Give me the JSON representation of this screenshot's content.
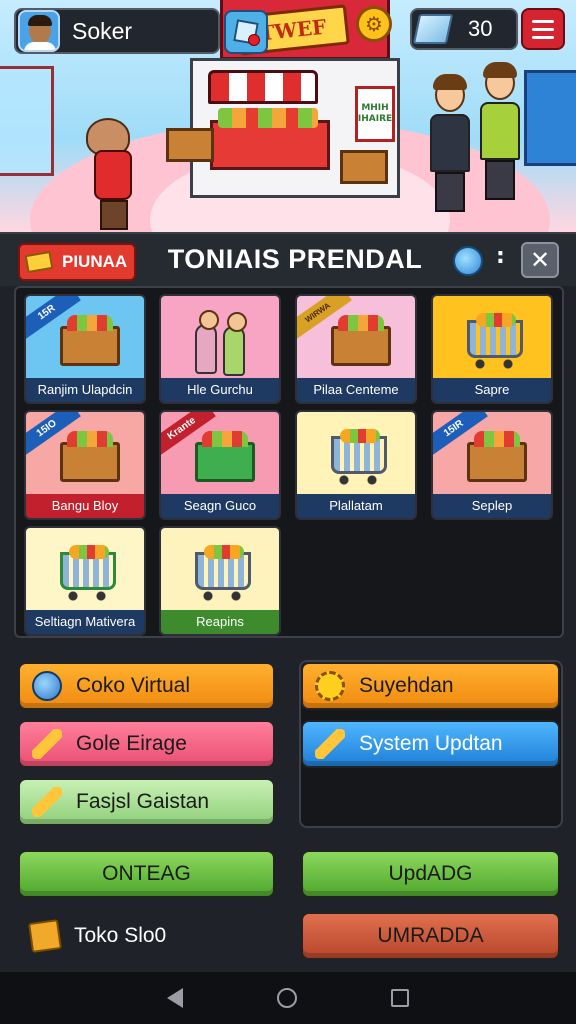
{
  "hud": {
    "player_name": "Soker",
    "currency_value": "30"
  },
  "scene": {
    "stall_sign": "TWEF",
    "poster_text": "MHIH IHAIRE"
  },
  "panel": {
    "tag_label": "PIUNAA",
    "title": "TONIAIS PRENDAL",
    "close_symbol": "✕",
    "colon": ":"
  },
  "cards": [
    {
      "label": "Ranjim Ulapdcin",
      "ribbon": "15R",
      "icon": "shop-crate-icon",
      "bg": "#6cc6f1"
    },
    {
      "label": "Hle Gurchu",
      "ribbon": "",
      "icon": "shoppers-icon",
      "bg": "#f7a5c3"
    },
    {
      "label": "Pilaa Centeme",
      "ribbon": "WIRWA",
      "icon": "produce-stand-icon",
      "bg": "#f7c0da"
    },
    {
      "label": "Sapre",
      "ribbon": "",
      "icon": "cart-produce-icon",
      "bg": "#ffc21f"
    },
    {
      "label": "Bangu Bloy",
      "ribbon": "15IO",
      "icon": "veggie-crate-icon",
      "bg": "#f7a7a4"
    },
    {
      "label": "Seagn Guco",
      "ribbon": "Krante",
      "icon": "basket-icon",
      "bg": "#f79bb3"
    },
    {
      "label": "Plallatam",
      "ribbon": "",
      "icon": "shelf-cart-icon",
      "bg": "#fff3b8"
    },
    {
      "label": "Seplep",
      "ribbon": "15IR",
      "icon": "tomato-crate-icon",
      "bg": "#f8a7a7"
    },
    {
      "label": "Seltiagn Mativera",
      "ribbon": "",
      "icon": "fruit-basket-icon",
      "bg": "#fff6c7"
    },
    {
      "label": "Reapins",
      "ribbon": "",
      "icon": "shopping-cart-icon",
      "bg": "#fff3bd"
    }
  ],
  "menu": {
    "coko_virtual": "Coko Virtual",
    "suyehdan": "Suyehdan",
    "gole_eirage": "Gole Eirage",
    "system_updtan": "System Updtan",
    "fasjsl_gaistan": "Fasjsl Gaistan",
    "onteag": "ONTEAG",
    "updadg": "UpdADG",
    "toko_sloo": "Toko Slo0",
    "umradda": "UMRADDA"
  },
  "colors": {
    "accent_red": "#d32430",
    "panel_bg": "#1f2228",
    "button_orange": "#f08a10",
    "button_blue": "#1f7fd6",
    "button_green": "#4fa62d"
  }
}
